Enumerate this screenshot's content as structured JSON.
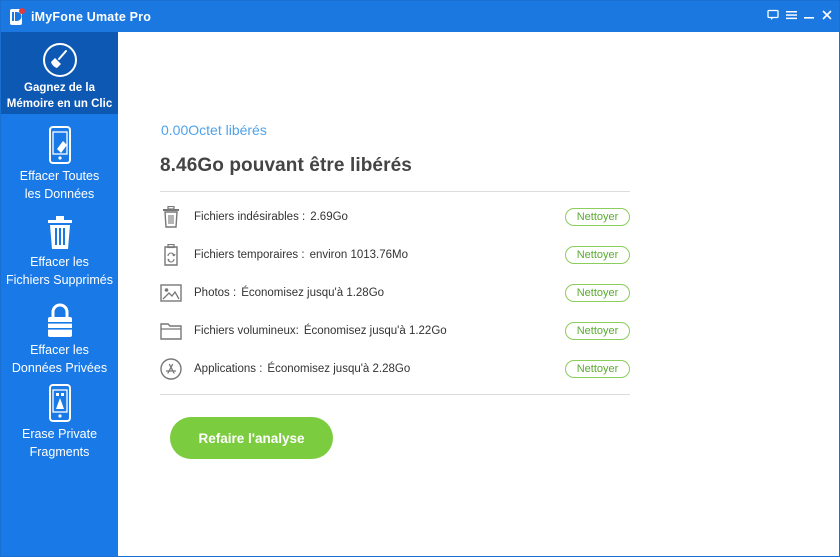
{
  "titlebar": {
    "title": "iMyFone Umate Pro"
  },
  "sidebar": {
    "items": [
      {
        "label": "Gagnez de la\nMémoire en un Clic",
        "icon": "broom-icon",
        "active": true
      },
      {
        "label": "Effacer Toutes\nles Données",
        "icon": "phone-erase-icon",
        "active": false
      },
      {
        "label": "Effacer les\nFichiers Supprimés",
        "icon": "trash-icon",
        "active": false
      },
      {
        "label": "Effacer les\nDonnées Privées",
        "icon": "lock-icon",
        "active": false
      },
      {
        "label": "Erase Private\nFragments",
        "icon": "phone-fragments-icon",
        "active": false
      }
    ]
  },
  "main": {
    "freed": "0.00Octet libérés",
    "headline": "8.46Go pouvant être libérés",
    "rows": [
      {
        "label": "Fichiers indésirables :",
        "value": "2.69Go",
        "button": "Nettoyer",
        "icon": "trash-can-icon"
      },
      {
        "label": "Fichiers temporaires :",
        "value": "environ 1013.76Mo",
        "button": "Nettoyer",
        "icon": "temp-file-icon"
      },
      {
        "label": "Photos :",
        "value": "Économisez jusqu'à 1.28Go",
        "button": "Nettoyer",
        "icon": "photo-icon"
      },
      {
        "label": "Fichiers volumineux:",
        "value": "Économisez jusqu'à 1.22Go",
        "button": "Nettoyer",
        "icon": "folder-icon"
      },
      {
        "label": "Applications :",
        "value": "Économisez jusqu'à 2.28Go",
        "button": "Nettoyer",
        "icon": "app-store-icon"
      }
    ],
    "rescan": "Refaire l'analyse"
  },
  "colors": {
    "titlebar": "#1a78e0",
    "sidebar": "#1979e6",
    "sidebar_active": "#0d58b3",
    "accent_green": "#7ccc3f",
    "freed_text": "#4fa3ea"
  }
}
